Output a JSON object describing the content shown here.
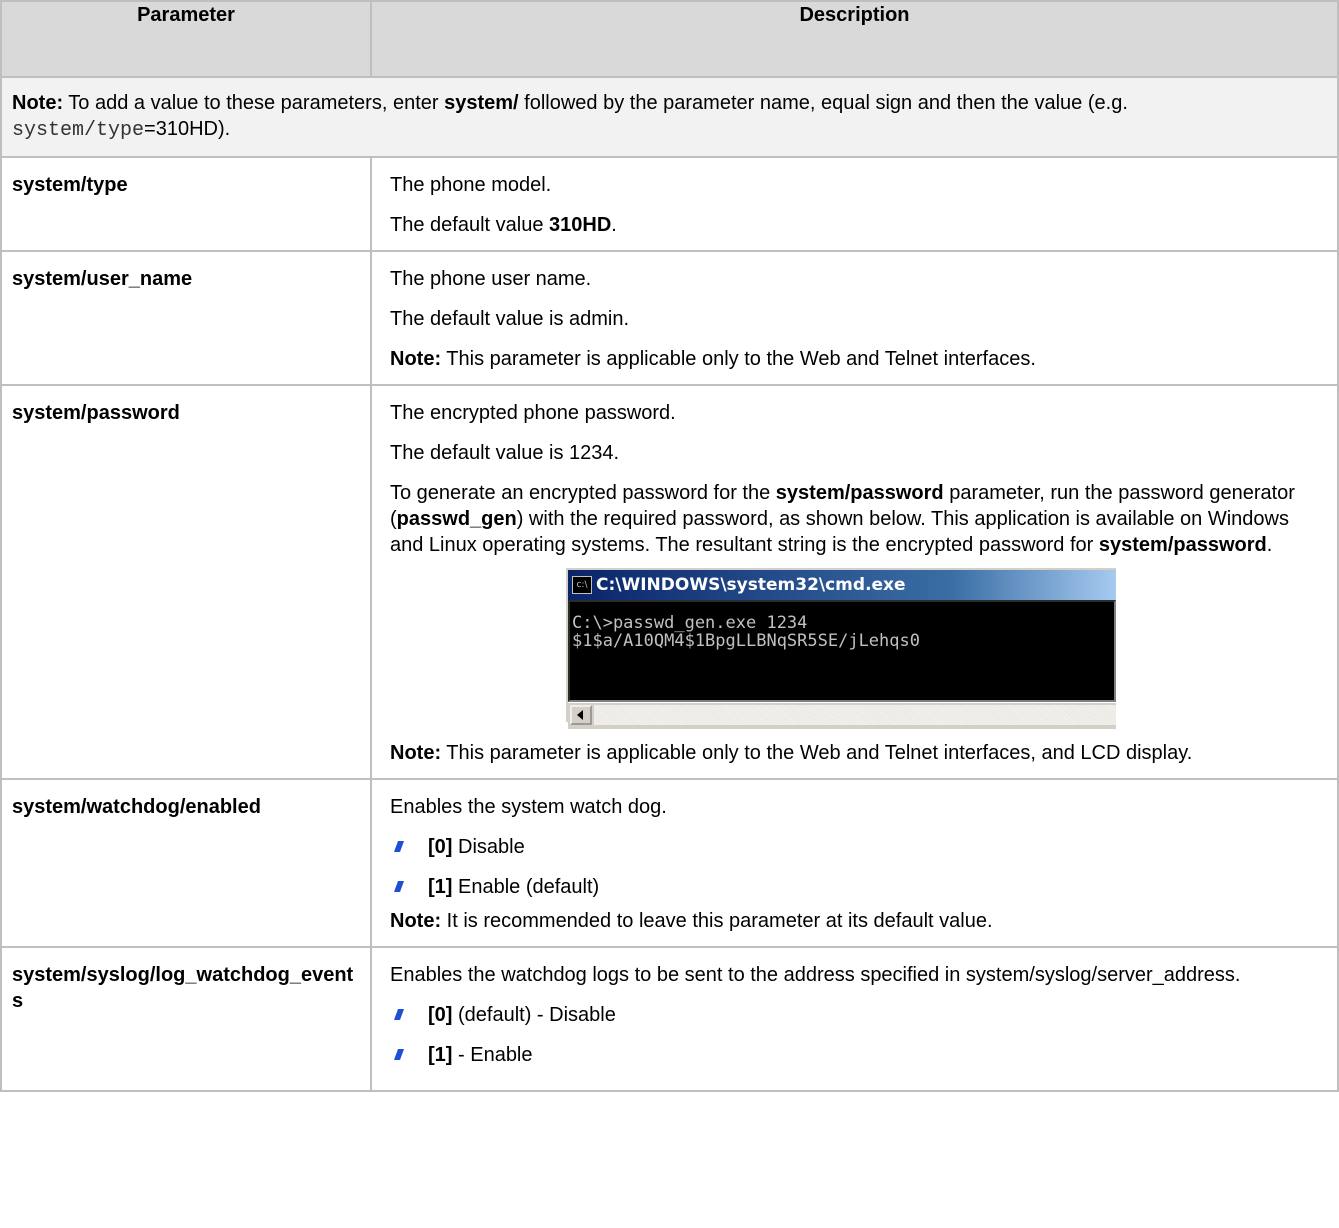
{
  "header": {
    "col_parameter": "Parameter",
    "col_description": "Description"
  },
  "intro_note": {
    "label": "Note:",
    "text1": " To add a value to these parameters, enter ",
    "bold": "system/",
    "text2": " followed by the parameter name, equal sign and then the value (e.g. ",
    "code": "system/type",
    "text3": "=310HD)."
  },
  "rows": {
    "type": {
      "name": "system/type",
      "desc": "The phone model.",
      "default_prefix": "The default value ",
      "default_value": "310HD",
      "default_suffix": "."
    },
    "user_name": {
      "name": "system/user_name",
      "desc": "The phone user name.",
      "default": "The default value is admin.",
      "note_label": "Note:",
      "note_text": " This parameter is applicable only to the Web and Telnet interfaces."
    },
    "password": {
      "name": "system/password",
      "desc": "The encrypted phone password.",
      "default": "The default value is 1234.",
      "gen_t1": "To generate an encrypted password for the ",
      "gen_b1": "system/password",
      "gen_t2": " parameter, run the password generator (",
      "gen_b2": "passwd_gen",
      "gen_t3": ") with the required password, as shown below. This application is available on Windows and Linux operating systems. The resultant string is the encrypted password for ",
      "gen_b3": "system/password",
      "gen_t4": ".",
      "cmd": {
        "icon": "c:\\",
        "title": "C:\\WINDOWS\\system32\\cmd.exe",
        "line1": "C:\\>passwd_gen.exe 1234",
        "line2": "$1$a/A10QM4$1BpgLLBNqSR5SE/jLehqs0"
      },
      "note_label": "Note:",
      "note_text": " This parameter is applicable only to the Web and Telnet interfaces, and LCD display."
    },
    "watchdog": {
      "name": "system/watchdog/enabled",
      "desc": "Enables the system watch dog.",
      "opt0_code": "[0]",
      "opt0_text": " Disable",
      "opt1_code": "[1]",
      "opt1_text": " Enable (default)",
      "note_label": "Note:",
      "note_text": " It is recommended to leave this parameter at its default value."
    },
    "syslog": {
      "name": "system/syslog/log_watchdog_events",
      "desc": "Enables the watchdog logs to be sent to the address specified in system/syslog/server_address.",
      "opt0_code": "[0]",
      "opt0_text": " (default) - Disable",
      "opt1_code": "[1]",
      "opt1_text": " - Enable"
    }
  },
  "colors": {
    "header_bg": "#d9d9d9",
    "note_bg": "#f2f2f2",
    "border": "#bfbfbf",
    "bullet": "#1e4fd6"
  },
  "icons": {
    "bullet": "blue-slanted-bullet-icon",
    "cmd": "cmd-window-icon"
  }
}
